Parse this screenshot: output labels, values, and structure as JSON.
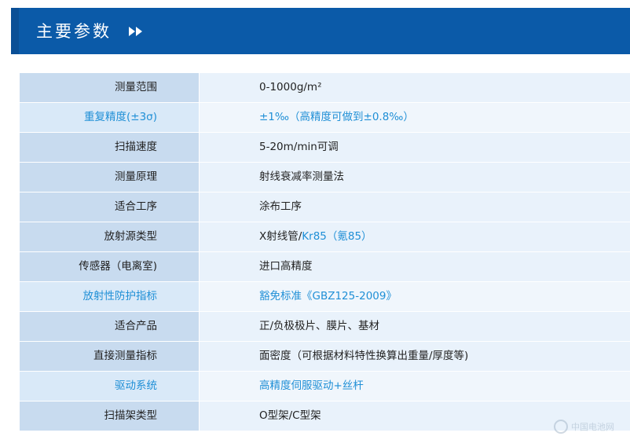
{
  "header": {
    "title": "主要参数"
  },
  "rows": [
    {
      "label": "测量范围",
      "value": "0-1000g/m²",
      "highlight": false
    },
    {
      "label": "重复精度(±3σ)",
      "value": "±1‰（高精度可做到±0.8‰）",
      "highlight": true
    },
    {
      "label": "扫描速度",
      "value": "5-20m/min可调",
      "highlight": false
    },
    {
      "label": "测量原理",
      "value": "射线衰减率测量法",
      "highlight": false
    },
    {
      "label": "适合工序",
      "value": "涂布工序",
      "highlight": false
    },
    {
      "label": "放射源类型",
      "value_prefix": "X射线管/",
      "value_suffix": "Kr85（氪85）",
      "highlight": false
    },
    {
      "label": "传感器（电离室)",
      "value": "进口高精度",
      "highlight": false
    },
    {
      "label": "放射性防护指标",
      "value": "豁免标准《GBZ125-2009》",
      "highlight": true
    },
    {
      "label": "适合产品",
      "value": "正/负极极片、膜片、基材",
      "highlight": false
    },
    {
      "label": "直接测量指标",
      "value": "面密度（可根据材料特性换算出重量/厚度等)",
      "highlight": false
    },
    {
      "label": "驱动系统",
      "value": "高精度伺服驱动+丝杆",
      "highlight": true
    },
    {
      "label": "扫描架类型",
      "value": "O型架/C型架",
      "highlight": false
    }
  ],
  "watermark": {
    "text": "中国电池网"
  },
  "colors": {
    "header_bg": "#0b5aa8",
    "label_bg": "#c8dbef",
    "value_bg": "#e9f2fb",
    "highlight_text": "#1f8fd6"
  }
}
